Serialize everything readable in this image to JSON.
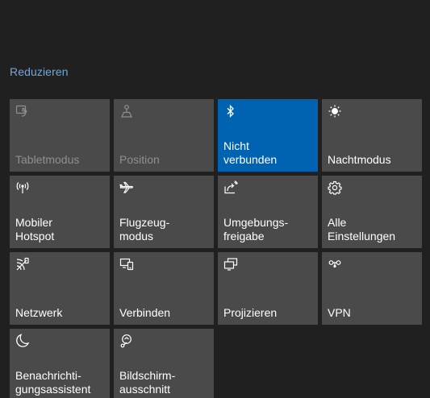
{
  "collapse_label": "Reduzieren",
  "colors": {
    "accent": "#0063b1",
    "tile": "#4a4a4a",
    "background": "#202020",
    "link": "#6fa8dc"
  },
  "tiles": [
    {
      "label": "Tabletmodus",
      "icon": "tablet-mode-icon",
      "state": "disabled"
    },
    {
      "label": "Position",
      "icon": "location-icon",
      "state": "disabled"
    },
    {
      "label": "Nicht\nverbunden",
      "icon": "bluetooth-icon",
      "state": "active"
    },
    {
      "label": "Nachtmodus",
      "icon": "night-light-icon",
      "state": "normal"
    },
    {
      "label": "Mobiler\nHotspot",
      "icon": "hotspot-icon",
      "state": "normal"
    },
    {
      "label": "Flugzeug-\nmodus",
      "icon": "airplane-icon",
      "state": "normal"
    },
    {
      "label": "Umgebungs-\nfreigabe",
      "icon": "share-icon",
      "state": "normal"
    },
    {
      "label": "Alle\nEinstellungen",
      "icon": "gear-icon",
      "state": "normal"
    },
    {
      "label": "Netzwerk",
      "icon": "network-icon",
      "state": "normal"
    },
    {
      "label": "Verbinden",
      "icon": "connect-icon",
      "state": "normal"
    },
    {
      "label": "Projizieren",
      "icon": "project-icon",
      "state": "normal"
    },
    {
      "label": "VPN",
      "icon": "vpn-icon",
      "state": "normal"
    },
    {
      "label": "Benachrichti-\ngungsassistent",
      "icon": "moon-icon",
      "state": "normal"
    },
    {
      "label": "Bildschirm-\nausschnitt",
      "icon": "snip-icon",
      "state": "normal"
    }
  ]
}
